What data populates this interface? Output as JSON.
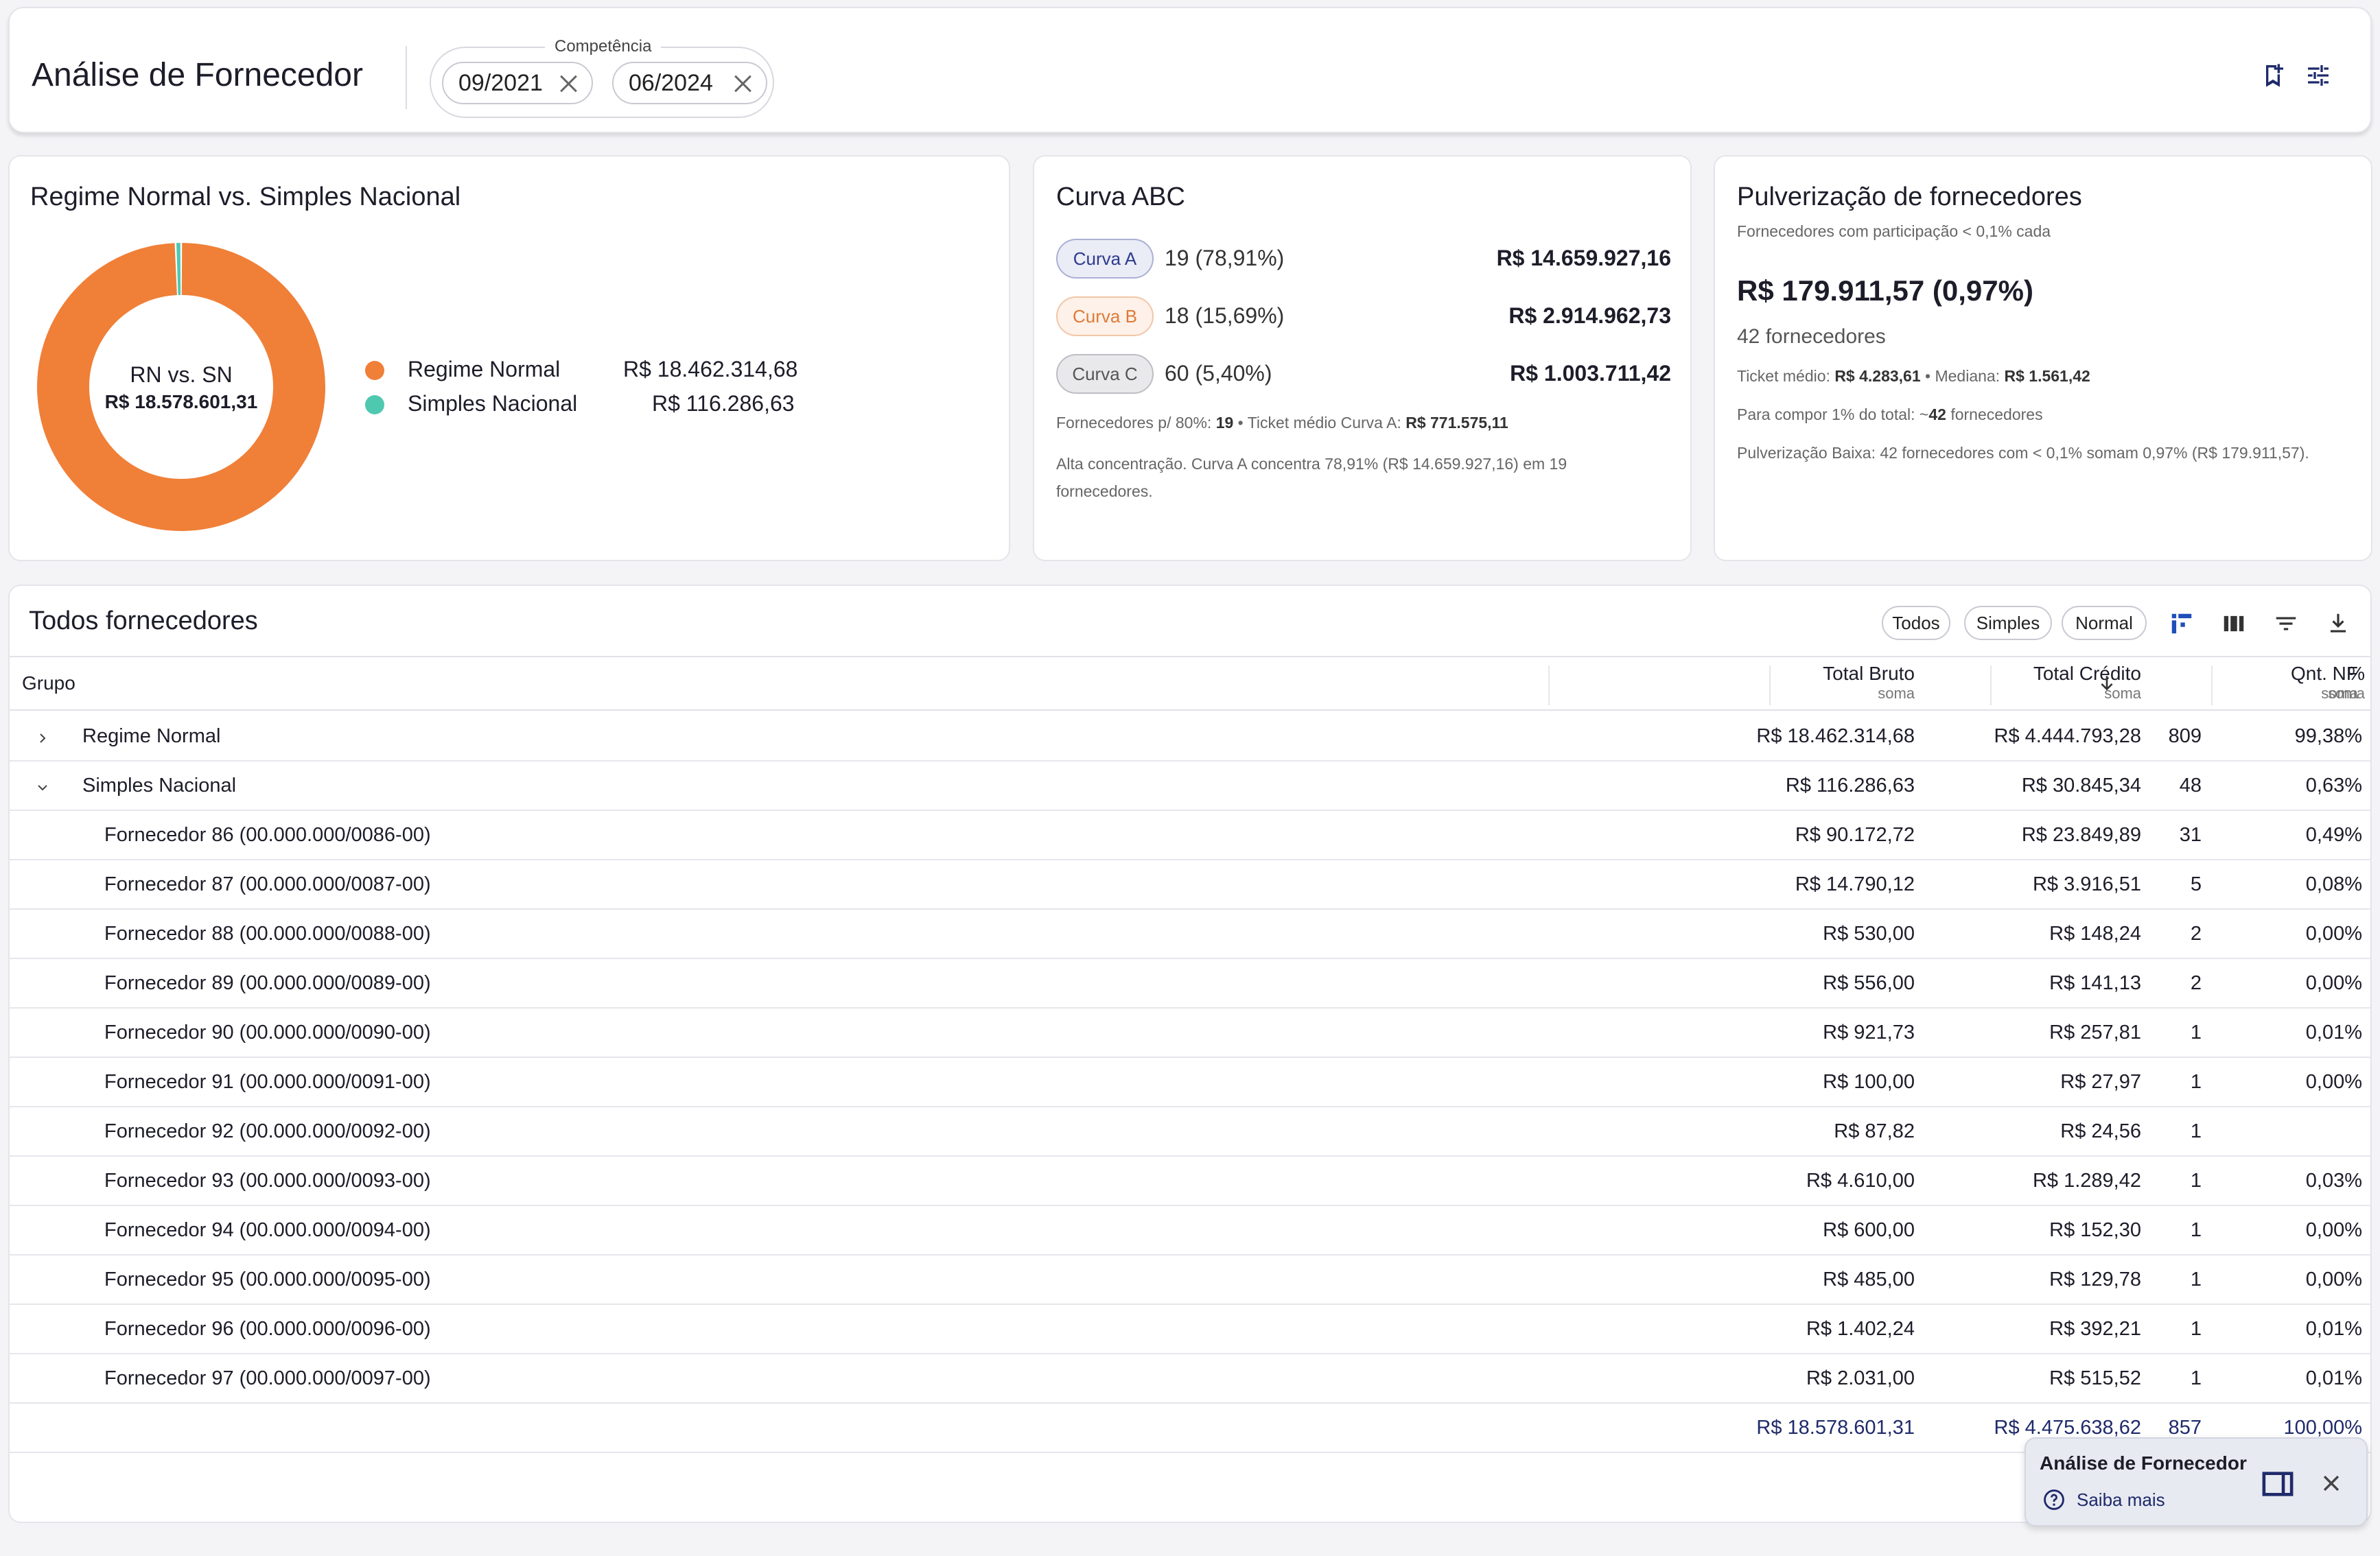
{
  "header": {
    "title": "Análise de Fornecedor",
    "competencia_label": "Competência",
    "date_from": "09/2021",
    "date_to": "06/2024",
    "icons": [
      "bookmark-icon",
      "tune-icon"
    ]
  },
  "rn_sn": {
    "title": "Regime Normal vs. Simples Nacional",
    "center_label": "RN vs. SN",
    "center_value": "R$ 18.578.601,31",
    "legend": [
      {
        "name": "Regime Normal",
        "value": "R$ 18.462.314,68",
        "color": "#f07f38"
      },
      {
        "name": "Simples Nacional",
        "value": "R$ 116.286,63",
        "color": "#4fc8b0"
      }
    ]
  },
  "chart_data": {
    "type": "pie",
    "categories": [
      "Regime Normal",
      "Simples Nacional"
    ],
    "values": [
      18462314.68,
      116286.63
    ]
  },
  "curva_abc": {
    "title": "Curva ABC",
    "rows": [
      {
        "label": "Curva A",
        "count": "19 (78,91%)",
        "value": "R$ 14.659.927,16"
      },
      {
        "label": "Curva B",
        "count": "18 (15,69%)",
        "value": "R$ 2.914.962,73"
      },
      {
        "label": "Curva C",
        "count": "60 (5,40%)",
        "value": "R$ 1.003.711,42"
      }
    ],
    "footer1_prefix": "Fornecedores p/ 80%:",
    "footer1_count": "19",
    "footer1_mid": "• Ticket médio Curva A:",
    "footer1_value": "R$ 771.575,11",
    "footer2": "Alta concentração. Curva A concentra 78,91% (R$ 14.659.927,16) em 19 fornecedores."
  },
  "pulverizacao": {
    "title": "Pulverização de fornecedores",
    "subtitle": "Fornecedores com participação < 0,1% cada",
    "value": "R$ 179.911,57 (0,97%)",
    "count": "42 fornecedores",
    "ticket_label": "Ticket médio:",
    "ticket_value": "R$ 4.283,61",
    "mediana_label": "• Mediana:",
    "mediana_value": "R$ 1.561,42",
    "compor_label": "Para compor 1% do total: ~",
    "compor_value": "42",
    "compor_suffix": "fornecedores",
    "note": "Pulverização Baixa: 42 fornecedores com < 0,1% somam 0,97% (R$ 179.911,57)."
  },
  "table": {
    "title": "Todos fornecedores",
    "filters": [
      "Todos",
      "Simples",
      "Normal"
    ],
    "columns": {
      "grupo": "Grupo",
      "bruto": "Total Bruto",
      "credito": "Total Crédito",
      "qnt": "Qnt. NF",
      "pct": "%",
      "sub": "soma"
    },
    "groups": [
      {
        "name": "Regime Normal",
        "bruto": "R$ 18.462.314,68",
        "credito": "R$ 4.444.793,28",
        "qnt": "809",
        "pct": "99,38%"
      },
      {
        "name": "Simples Nacional",
        "bruto": "R$ 116.286,63",
        "credito": "R$ 30.845,34",
        "qnt": "48",
        "pct": "0,63%"
      }
    ],
    "rows": [
      {
        "name": "Fornecedor 86 (00.000.000/0086-00)",
        "bruto": "R$ 90.172,72",
        "credito": "R$ 23.849,89",
        "qnt": "31",
        "pct": "0,49%"
      },
      {
        "name": "Fornecedor 87 (00.000.000/0087-00)",
        "bruto": "R$ 14.790,12",
        "credito": "R$ 3.916,51",
        "qnt": "5",
        "pct": "0,08%"
      },
      {
        "name": "Fornecedor 88 (00.000.000/0088-00)",
        "bruto": "R$ 530,00",
        "credito": "R$ 148,24",
        "qnt": "2",
        "pct": "0,00%"
      },
      {
        "name": "Fornecedor 89 (00.000.000/0089-00)",
        "bruto": "R$ 556,00",
        "credito": "R$ 141,13",
        "qnt": "2",
        "pct": "0,00%"
      },
      {
        "name": "Fornecedor 90 (00.000.000/0090-00)",
        "bruto": "R$ 921,73",
        "credito": "R$ 257,81",
        "qnt": "1",
        "pct": "0,01%"
      },
      {
        "name": "Fornecedor 91 (00.000.000/0091-00)",
        "bruto": "R$ 100,00",
        "credito": "R$ 27,97",
        "qnt": "1",
        "pct": "0,00%"
      },
      {
        "name": "Fornecedor 92 (00.000.000/0092-00)",
        "bruto": "R$ 87,82",
        "credito": "R$ 24,56",
        "qnt": "1",
        "pct": ""
      },
      {
        "name": "Fornecedor 93 (00.000.000/0093-00)",
        "bruto": "R$ 4.610,00",
        "credito": "R$ 1.289,42",
        "qnt": "1",
        "pct": "0,03%"
      },
      {
        "name": "Fornecedor 94 (00.000.000/0094-00)",
        "bruto": "R$ 600,00",
        "credito": "R$ 152,30",
        "qnt": "1",
        "pct": "0,00%"
      },
      {
        "name": "Fornecedor 95 (00.000.000/0095-00)",
        "bruto": "R$ 485,00",
        "credito": "R$ 129,78",
        "qnt": "1",
        "pct": "0,00%"
      },
      {
        "name": "Fornecedor 96 (00.000.000/0096-00)",
        "bruto": "R$ 1.402,24",
        "credito": "R$ 392,21",
        "qnt": "1",
        "pct": "0,01%"
      },
      {
        "name": "Fornecedor 97 (00.000.000/0097-00)",
        "bruto": "R$ 2.031,00",
        "credito": "R$ 515,52",
        "qnt": "1",
        "pct": "0,01%"
      }
    ],
    "total": {
      "bruto": "R$ 18.578.601,31",
      "credito": "R$ 4.475.638,62",
      "qnt": "857",
      "pct": "100,00%"
    }
  },
  "toast": {
    "title": "Análise de Fornecedor",
    "link": "Saiba mais"
  }
}
